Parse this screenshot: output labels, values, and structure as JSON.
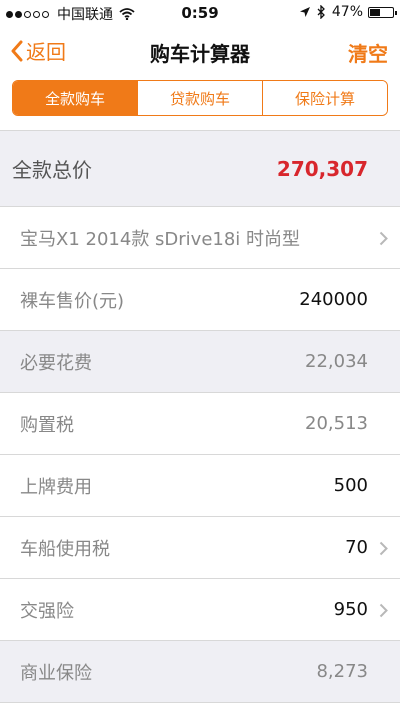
{
  "status": {
    "carrier": "中国联通",
    "time": "0:59",
    "battery": "47%",
    "battery_level": 0.47,
    "signal_bars_filled": 2,
    "signal_bars_total": 5
  },
  "nav": {
    "back_label": "返回",
    "title": "购车计算器",
    "clear_label": "清空"
  },
  "tabs": [
    {
      "label": "全款购车",
      "active": true
    },
    {
      "label": "贷款购车",
      "active": false
    },
    {
      "label": "保险计算",
      "active": false
    }
  ],
  "total": {
    "label": "全款总价",
    "value": "270,307"
  },
  "model": {
    "label": "宝马X1 2014款 sDrive18i 时尚型"
  },
  "bare_price": {
    "label": "裸车售价(元)",
    "value": "240000"
  },
  "necessary": {
    "label": "必要花费",
    "value": "22,034"
  },
  "purchase_tax": {
    "label": "购置税",
    "value": "20,513"
  },
  "plate_fee": {
    "label": "上牌费用",
    "value": "500"
  },
  "vehicle_tax": {
    "label": "车船使用税",
    "value": "70"
  },
  "compulsory_insurance": {
    "label": "交强险",
    "value": "950"
  },
  "commercial_insurance": {
    "label": "商业保险",
    "value": "8,273"
  },
  "colors": {
    "accent": "#f07a18",
    "total_red": "#d8262c",
    "section_gray": "#efeff4"
  },
  "icons": {
    "back": "chevron-left-icon",
    "row": "chevron-right-icon",
    "wifi": "wifi-icon",
    "location": "location-arrow-icon",
    "bluetooth": "bluetooth-icon",
    "battery": "battery-icon"
  }
}
